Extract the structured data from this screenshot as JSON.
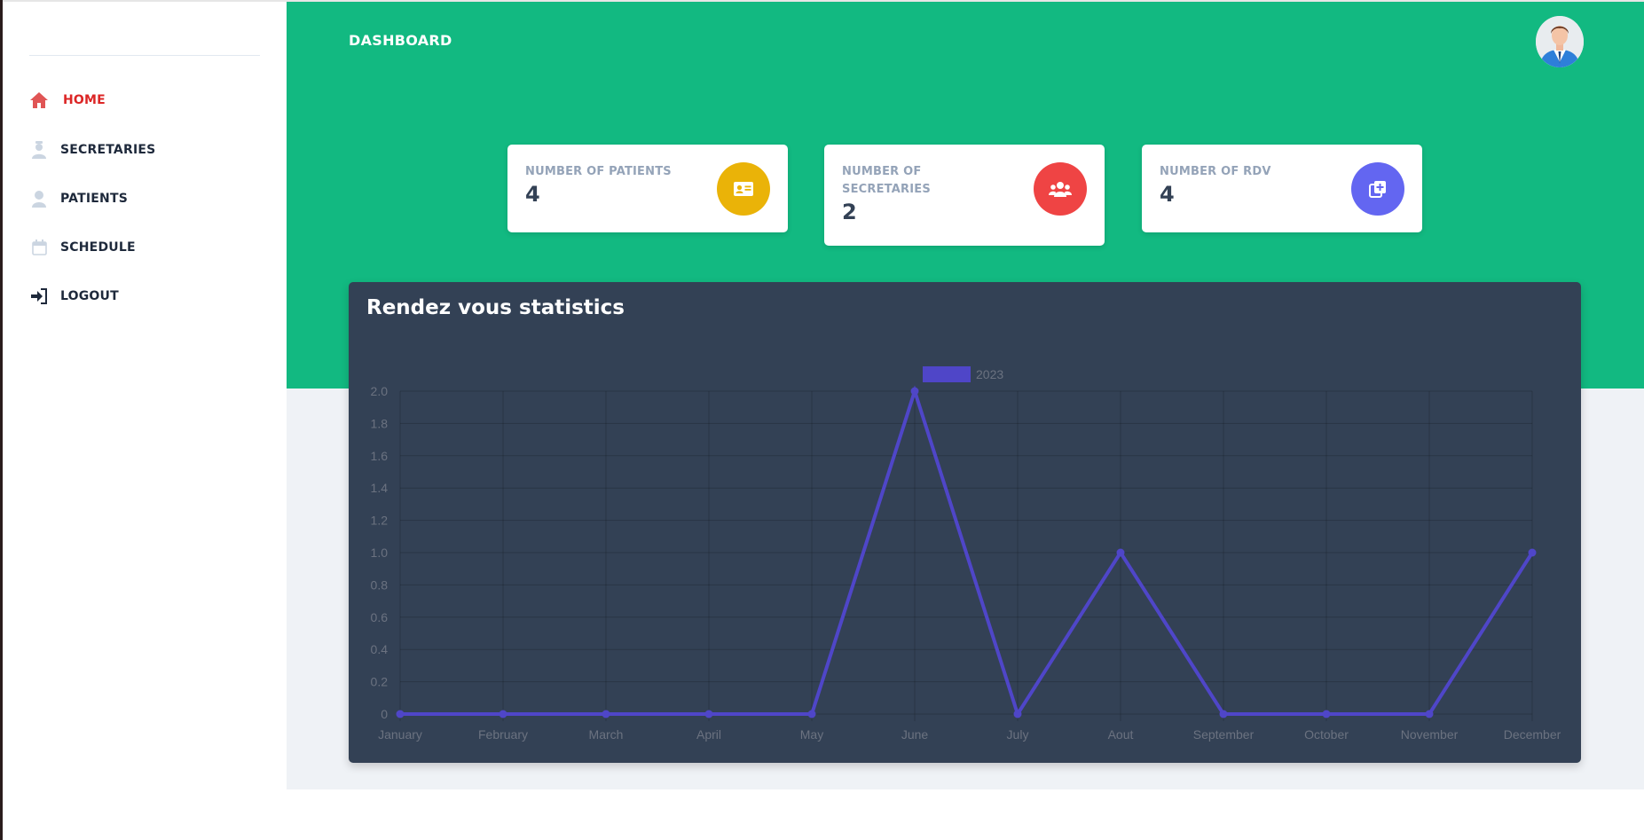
{
  "sidebar": {
    "items": [
      {
        "label": "HOME",
        "icon": "home-icon",
        "active": true
      },
      {
        "label": "SECRETARIES",
        "icon": "secretary-icon",
        "active": false
      },
      {
        "label": "PATIENTS",
        "icon": "user-icon",
        "active": false
      },
      {
        "label": "SCHEDULE",
        "icon": "calendar-icon",
        "active": false
      },
      {
        "label": "LOGOUT",
        "icon": "logout-icon",
        "active": false
      }
    ]
  },
  "header": {
    "title": "DASHBOARD",
    "avatar_icon": "doctor-avatar-icon"
  },
  "cards": [
    {
      "label": "NUMBER OF PATIENTS",
      "value": "4",
      "icon": "id-card-icon",
      "color": "#eab308"
    },
    {
      "label": "NUMBER OF SECRETARIES",
      "value": "2",
      "icon": "users-icon",
      "color": "#ef4444"
    },
    {
      "label": "NUMBER OF RDV",
      "value": "4",
      "icon": "copy-plus-icon",
      "color": "#6366f1"
    }
  ],
  "chart": {
    "title": "Rendez vous statistics"
  },
  "colors": {
    "accent": "#12b981",
    "active_nav": "#dc2626",
    "panel": "#334155",
    "series": "#4f46c8"
  },
  "chart_data": {
    "type": "line",
    "categories": [
      "January",
      "February",
      "March",
      "April",
      "May",
      "June",
      "July",
      "Aout",
      "September",
      "October",
      "November",
      "December"
    ],
    "series": [
      {
        "name": "2023",
        "values": [
          0,
          0,
          0,
          0,
          0,
          2,
          0,
          1,
          0,
          0,
          0,
          1
        ]
      }
    ],
    "ylim": [
      0,
      2
    ],
    "yticks": [
      "0",
      "0.2",
      "0.4",
      "0.6",
      "0.8",
      "1.0",
      "1.2",
      "1.4",
      "1.6",
      "1.8",
      "2.0"
    ],
    "grid": true,
    "legend": "top-center"
  }
}
